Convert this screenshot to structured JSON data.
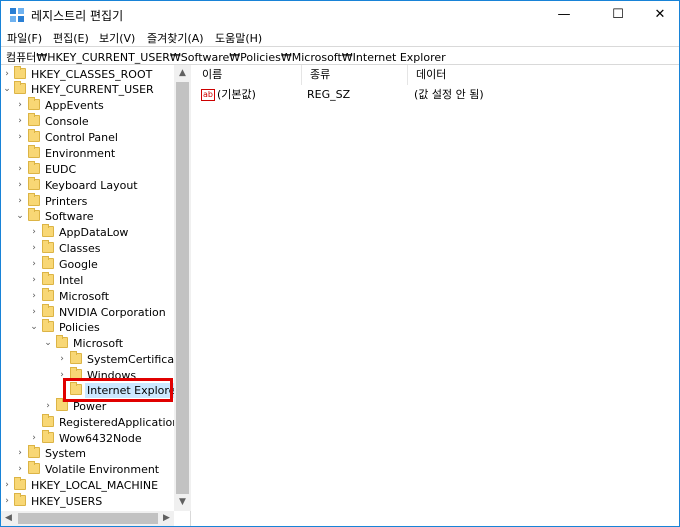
{
  "window": {
    "title": "레지스트리 편집기",
    "controls": {
      "minimize": "—",
      "maximize": "☐",
      "close": "✕"
    }
  },
  "menu": [
    {
      "label": "파일(F)"
    },
    {
      "label": "편집(E)"
    },
    {
      "label": "보기(V)"
    },
    {
      "label": "즐겨찾기(A)"
    },
    {
      "label": "도움말(H)"
    }
  ],
  "address": "컴퓨터₩HKEY_CURRENT_USER₩Software₩Policies₩Microsoft₩Internet Explorer",
  "tree": [
    {
      "label": "HKEY_CLASSES_ROOT",
      "expander": "›"
    },
    {
      "label": "HKEY_CURRENT_USER",
      "expander": "⌄"
    },
    {
      "label": "AppEvents",
      "expander": "›"
    },
    {
      "label": "Console",
      "expander": "›"
    },
    {
      "label": "Control Panel",
      "expander": "›"
    },
    {
      "label": "Environment",
      "expander": ""
    },
    {
      "label": "EUDC",
      "expander": "›"
    },
    {
      "label": "Keyboard Layout",
      "expander": "›"
    },
    {
      "label": "Printers",
      "expander": "›"
    },
    {
      "label": "Software",
      "expander": "⌄"
    },
    {
      "label": "AppDataLow",
      "expander": "›"
    },
    {
      "label": "Classes",
      "expander": "›"
    },
    {
      "label": "Google",
      "expander": "›"
    },
    {
      "label": "Intel",
      "expander": "›"
    },
    {
      "label": "Microsoft",
      "expander": "›"
    },
    {
      "label": "NVIDIA Corporation",
      "expander": "›"
    },
    {
      "label": "Policies",
      "expander": "⌄"
    },
    {
      "label": "Microsoft",
      "expander": "⌄"
    },
    {
      "label": "SystemCertificates",
      "expander": "›"
    },
    {
      "label": "Windows",
      "expander": "›"
    },
    {
      "label": "Internet Explorer",
      "expander": "",
      "selected": true
    },
    {
      "label": "Power",
      "expander": "›"
    },
    {
      "label": "RegisteredApplications",
      "expander": ""
    },
    {
      "label": "Wow6432Node",
      "expander": "›"
    },
    {
      "label": "System",
      "expander": "›"
    },
    {
      "label": "Volatile Environment",
      "expander": "›"
    },
    {
      "label": "HKEY_LOCAL_MACHINE",
      "expander": "›"
    },
    {
      "label": "HKEY_USERS",
      "expander": "›"
    }
  ],
  "columns": {
    "name": "이름",
    "type": "종류",
    "data": "데이터"
  },
  "values": [
    {
      "icon": "ab",
      "name": "(기본값)",
      "type": "REG_SZ",
      "data": "(값 설정 안 됨)"
    }
  ],
  "colors": {
    "selection": "#cce8ff",
    "highlight_box": "#e00000",
    "folder": "#f8d775"
  }
}
